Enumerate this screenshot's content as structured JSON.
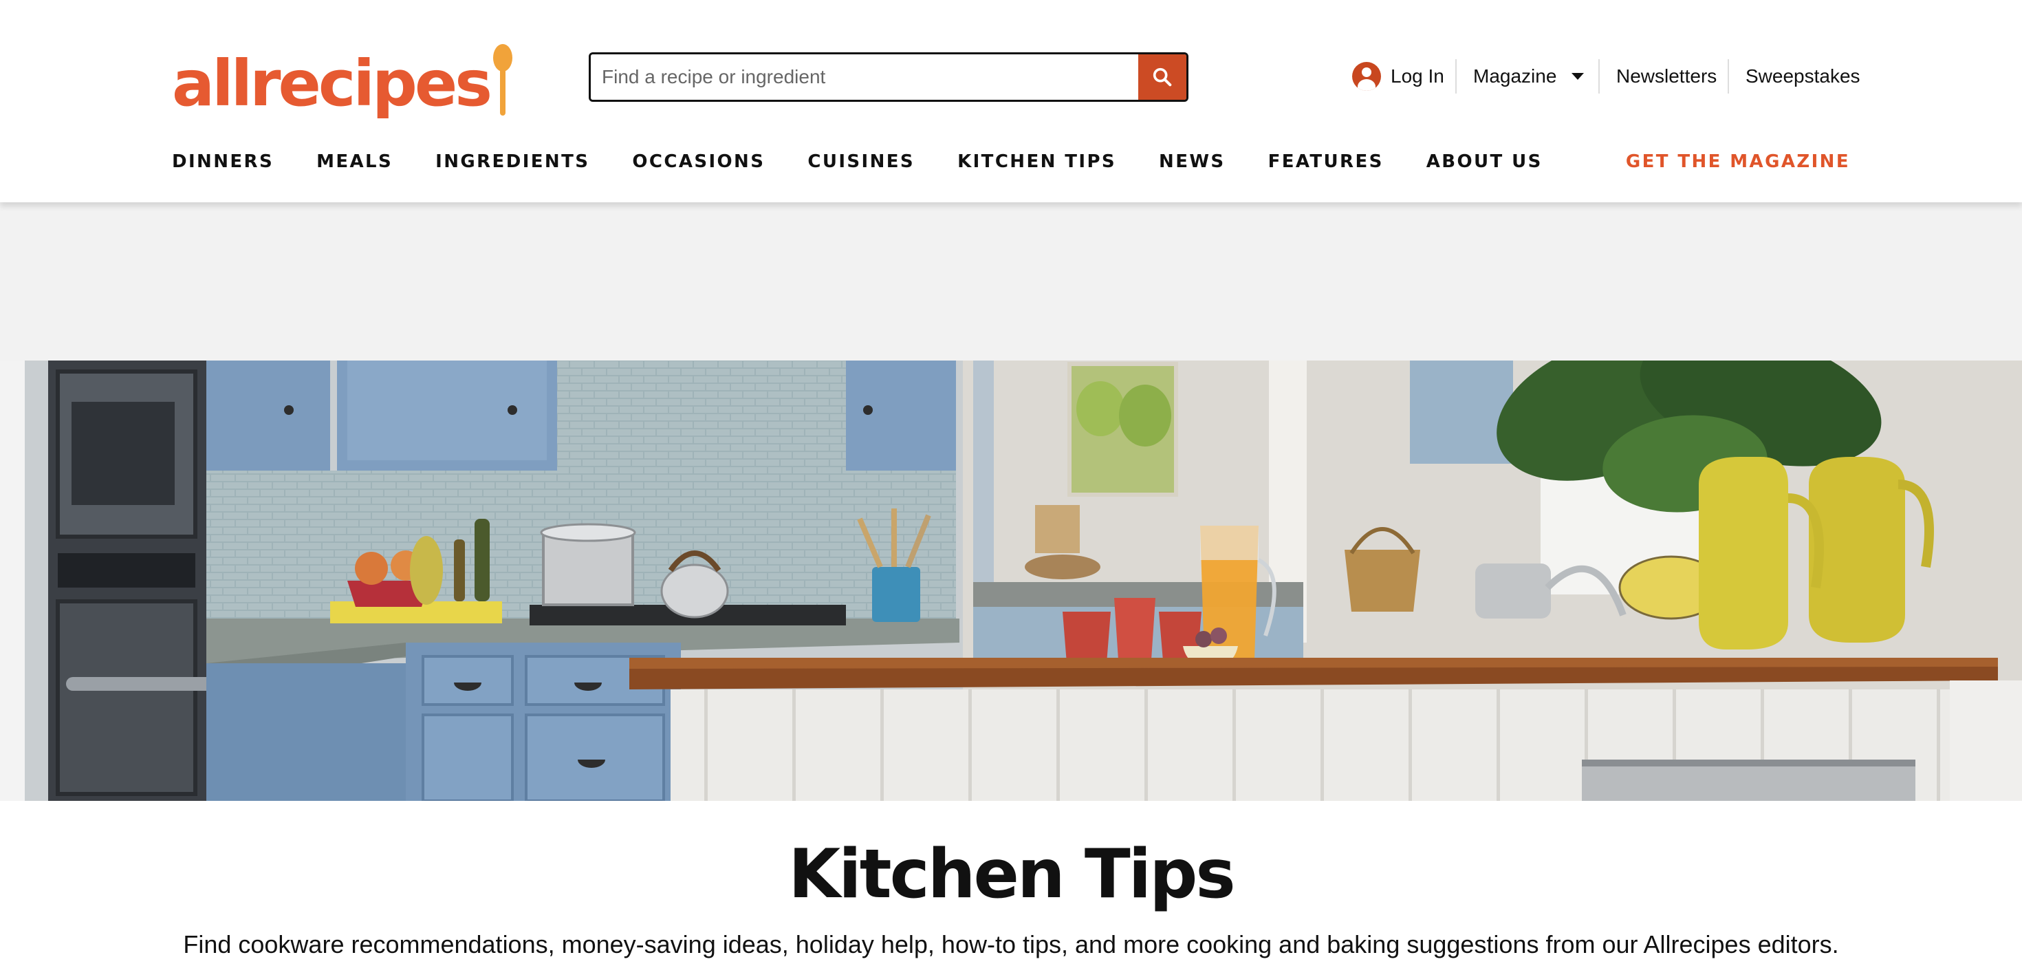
{
  "brand": {
    "logo_text": "allrecipes",
    "accent": "#e65a31",
    "spoon_color": "#f1a33a"
  },
  "search": {
    "placeholder": "Find a recipe or ingredient",
    "value": "",
    "icon": "search-icon"
  },
  "utility_nav": {
    "login": {
      "label": "Log In",
      "icon": "user-avatar-icon"
    },
    "magazine": {
      "label": "Magazine",
      "icon": "caret-down-icon"
    },
    "newsletters": "Newsletters",
    "sweepstakes": "Sweepstakes"
  },
  "main_nav": {
    "items": [
      "DINNERS",
      "MEALS",
      "INGREDIENTS",
      "OCCASIONS",
      "CUISINES",
      "KITCHEN TIPS",
      "NEWS",
      "FEATURES",
      "ABOUT US"
    ],
    "cta": "GET THE MAGAZINE"
  },
  "page": {
    "title": "Kitchen Tips",
    "description": "Find cookware recommendations, money-saving ideas, holiday help, how-to tips, and more cooking and baking suggestions from our Allrecipes editors."
  }
}
